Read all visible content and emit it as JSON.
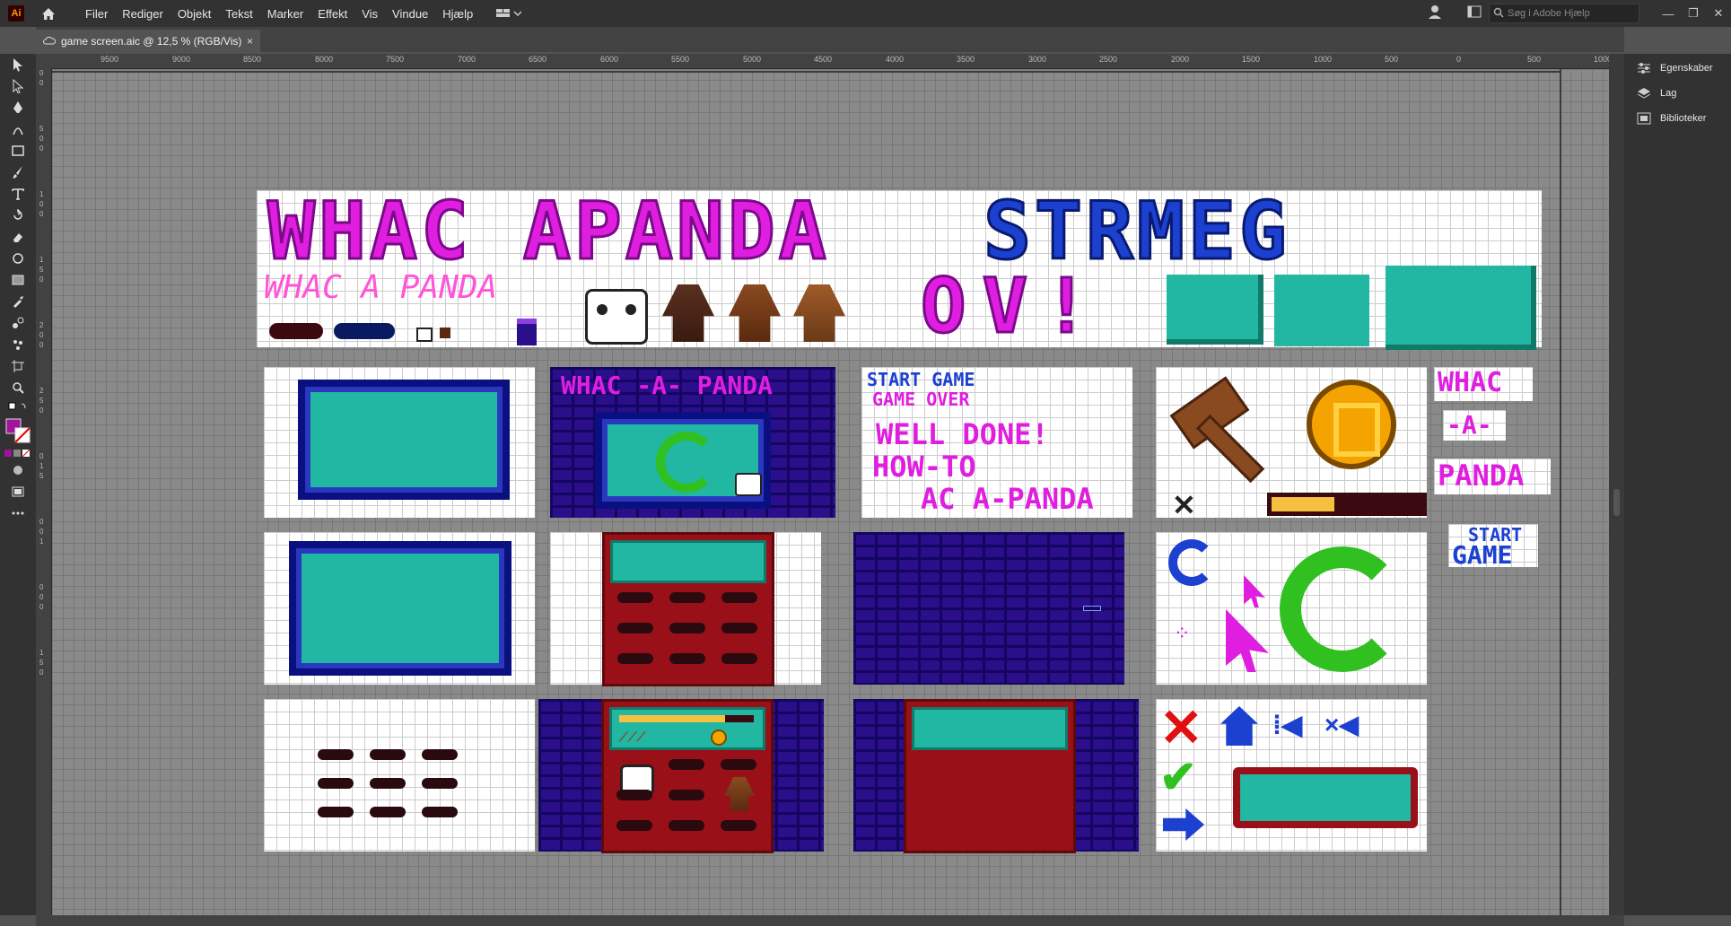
{
  "app": {
    "logo": "Ai"
  },
  "menu": [
    "Filer",
    "Rediger",
    "Objekt",
    "Tekst",
    "Marker",
    "Effekt",
    "Vis",
    "Vindue",
    "Hjælp"
  ],
  "search": {
    "placeholder": "Søg i Adobe Hjælp"
  },
  "document_tab": {
    "title": "game screen.aic @ 12,5 % (RGB/Vis)",
    "close": "×"
  },
  "ruler_top": [
    "9500",
    "9000",
    "8500",
    "8000",
    "7500",
    "7000",
    "6500",
    "6000",
    "5500",
    "5000",
    "4500",
    "4000",
    "3500",
    "3000",
    "2500",
    "2000",
    "1500",
    "1000",
    "500",
    "0",
    "500",
    "1000"
  ],
  "ruler_left": [
    "0",
    "0",
    "5",
    "0",
    "0",
    "1",
    "0",
    "0",
    "1",
    "5",
    "0",
    "2",
    "0",
    "0",
    "2",
    "5",
    "0",
    "0",
    "1",
    "5",
    "0",
    "0",
    "1",
    "0",
    "0",
    "0",
    "1",
    "5",
    "0"
  ],
  "panels": [
    {
      "label": "Egenskaber",
      "icon": "properties-icon"
    },
    {
      "label": "Lag",
      "icon": "layers-icon"
    },
    {
      "label": "Biblioteker",
      "icon": "libraries-icon"
    }
  ],
  "window_buttons": [
    "—",
    "❐",
    "✕"
  ],
  "artwork": {
    "title_main": "WHAC APANDA",
    "title_strmeg": "STRMEG",
    "title_sub": "WHAC A PANDA",
    "title_ov": "OV!",
    "logo_box": "WHAC -A- PANDA",
    "menu_texts": [
      "START GAME",
      "GAME OVER",
      "WELL DONE!",
      "HOW-TO",
      "AC  A-PANDA"
    ],
    "side_logo": [
      "WHAC",
      "-A-",
      "PANDA"
    ],
    "start_button": [
      "START",
      "GAME"
    ]
  },
  "colors": {
    "accent_magenta": "#e01ee0",
    "accent_blue": "#1c40d0",
    "teal": "#21b7a2",
    "brick": "#2a0e8a",
    "cabinet_red": "#9a1018"
  }
}
